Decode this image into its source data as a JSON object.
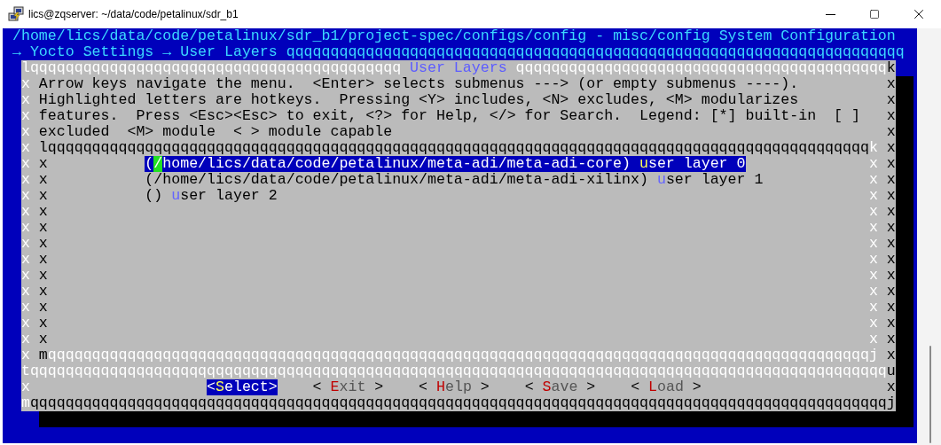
{
  "window": {
    "title": "lics@zqserver: ~/data/code/petalinux/sdr_b1"
  },
  "terminal": {
    "header": "/home/lics/data/code/petalinux/sdr_b1/project-spec/configs/config - misc/config System Configuration",
    "breadcrumb": "→ Yocto Settings → User Layers",
    "breadcrumb_rule": "qqqqqqqqqqqqqqqqqqqqqqqqqqqqqqqqqqqqqqqqqqqqqqqqqqqqqqqqqqqqqqqqqqqqqq",
    "dialog": {
      "title": "User Layers",
      "top_rule_left": "qqqqqqqqqqqqqqqqqqqqqqqqqqqqqqqqqqqqqqqqqq",
      "top_rule_right": "qqqqqqqqqqqqqqqqqqqqqqqqqqqqqqqqqqqqqqqqqq",
      "left_edge": [
        "l",
        "x",
        "x",
        "x",
        "x",
        "x",
        "x",
        "x",
        "x",
        "x",
        "x",
        "x",
        "x",
        "x",
        "x",
        "x",
        "x",
        "x",
        "x",
        "t",
        "x",
        "m"
      ],
      "right_edge": [
        "k",
        "x",
        "x",
        "x",
        "x",
        "x",
        "x",
        "x",
        "x",
        "x",
        "x",
        "x",
        "x",
        "x",
        "x",
        "x",
        "x",
        "x",
        "x",
        "u",
        "x",
        "j"
      ],
      "help_lines": [
        "Arrow keys navigate the menu.  <Enter> selects submenus ---> (or empty submenus ----).",
        "Highlighted letters are hotkeys.  Pressing <Y> includes, <N> excludes, <M> modularizes",
        "features.  Press <Esc><Esc> to exit, <?> for Help, </> for Search.  Legend: [*] built-in  [ ]",
        "excluded  <M> module  < > module capable"
      ],
      "list_frame": {
        "top_rule": "qqqqqqqqqqqqqqqqqqqqqqqqqqqqqqqqqqqqqqqqqqqqqqqqqqqqqqqqqqqqqqqqqqqqqqqqqqqqqqqqqqqqqqqqqqqqq",
        "bottom_rule": "qqqqqqqqqqqqqqqqqqqqqqqqqqqqqqqqqqqqqqqqqqqqqqqqqqqqqqqqqqqqqqqqqqqqqqqqqqqqqqqqqqqqqqqqqqqqq",
        "left_edge": [
          "l",
          "x",
          "x",
          "x",
          "x",
          "x",
          "x",
          "x",
          "x",
          "x",
          "x",
          "x",
          "x",
          "m"
        ],
        "right_edge": [
          "k",
          "x",
          "x",
          "x",
          "x",
          "x",
          "x",
          "x",
          "x",
          "x",
          "x",
          "x",
          "x",
          "j"
        ]
      },
      "items": [
        {
          "value": "(/home/lics/data/code/petalinux/meta-adi/meta-adi-core)",
          "hotkey": "u",
          "rest": "ser layer 0",
          "selected": true,
          "cursor": true
        },
        {
          "value": "(/home/lics/data/code/petalinux/meta-adi/meta-adi-xilinx)",
          "hotkey": "u",
          "rest": "ser layer 1",
          "selected": false,
          "cursor": false
        },
        {
          "value": "()",
          "hotkey": "u",
          "rest": "ser layer 2",
          "selected": false,
          "cursor": false
        }
      ],
      "separator_rule": "qqqqqqqqqqqqqqqqqqqqqqqqqqqqqqqqqqqqqqqqqqqqqqqqqqqqqqqqqqqqqqqqqqqqqqqqqqqqqqqqqqqqqqqqqqqqqqqqq",
      "buttons": [
        {
          "open": "<",
          "hotkey": "S",
          "rest": "elect",
          "close": ">",
          "selected": true
        },
        {
          "open": "< ",
          "hotkey": "E",
          "rest": "xit",
          "close": " >",
          "selected": false
        },
        {
          "open": "< ",
          "hotkey": "H",
          "rest": "elp",
          "close": " >",
          "selected": false
        },
        {
          "open": "< ",
          "hotkey": "S",
          "rest": "ave",
          "close": " >",
          "selected": false
        },
        {
          "open": "< ",
          "hotkey": "L",
          "rest": "oad",
          "close": " >",
          "selected": false
        }
      ],
      "bottom_rule": "qqqqqqqqqqqqqqqqqqqqqqqqqqqqqqqqqqqqqqqqqqqqqqqqqqqqqqqqqqqqqqqqqqqqqqqqqqqqqqqqqqqqqqqqqqqqqqqqq"
    }
  }
}
